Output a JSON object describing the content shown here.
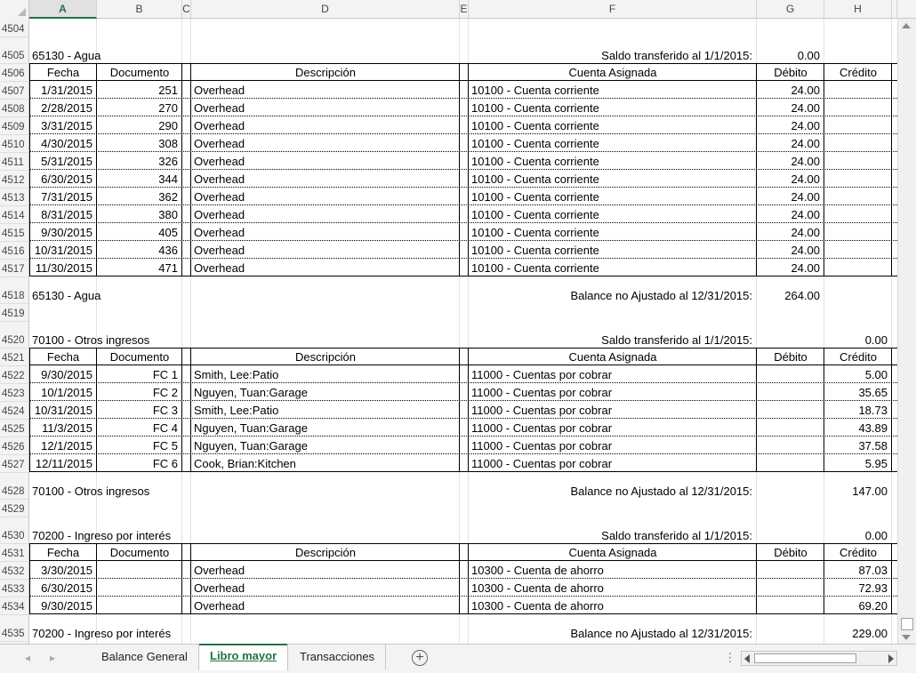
{
  "columns": [
    "A",
    "B",
    "C",
    "D",
    "E",
    "F",
    "G",
    "H"
  ],
  "row_numbers": [
    "4504",
    "4505",
    "4506",
    "4507",
    "4508",
    "4509",
    "4510",
    "4511",
    "4512",
    "4513",
    "4514",
    "4515",
    "4516",
    "4517",
    "4518",
    "4519",
    "4520",
    "4521",
    "4522",
    "4523",
    "4524",
    "4525",
    "4526",
    "4527",
    "4528",
    "4529",
    "4530",
    "4531",
    "4532",
    "4533",
    "4534",
    "4535"
  ],
  "headers": {
    "fecha": "Fecha",
    "documento": "Documento",
    "descripcion": "Descripción",
    "cuenta": "Cuenta Asignada",
    "debito": "Débito",
    "credito": "Crédito"
  },
  "sections": [
    {
      "account": "65130 - Agua",
      "opening_label": "Saldo transferido al 1/1/2015:",
      "opening_debit": "0.00",
      "opening_credit": "",
      "rows": [
        {
          "fecha": "1/31/2015",
          "doc": "251",
          "desc": "Overhead",
          "cuenta": "10100 - Cuenta corriente",
          "debito": "24.00",
          "credito": ""
        },
        {
          "fecha": "2/28/2015",
          "doc": "270",
          "desc": "Overhead",
          "cuenta": "10100 - Cuenta corriente",
          "debito": "24.00",
          "credito": ""
        },
        {
          "fecha": "3/31/2015",
          "doc": "290",
          "desc": "Overhead",
          "cuenta": "10100 - Cuenta corriente",
          "debito": "24.00",
          "credito": ""
        },
        {
          "fecha": "4/30/2015",
          "doc": "308",
          "desc": "Overhead",
          "cuenta": "10100 - Cuenta corriente",
          "debito": "24.00",
          "credito": ""
        },
        {
          "fecha": "5/31/2015",
          "doc": "326",
          "desc": "Overhead",
          "cuenta": "10100 - Cuenta corriente",
          "debito": "24.00",
          "credito": ""
        },
        {
          "fecha": "6/30/2015",
          "doc": "344",
          "desc": "Overhead",
          "cuenta": "10100 - Cuenta corriente",
          "debito": "24.00",
          "credito": ""
        },
        {
          "fecha": "7/31/2015",
          "doc": "362",
          "desc": "Overhead",
          "cuenta": "10100 - Cuenta corriente",
          "debito": "24.00",
          "credito": ""
        },
        {
          "fecha": "8/31/2015",
          "doc": "380",
          "desc": "Overhead",
          "cuenta": "10100 - Cuenta corriente",
          "debito": "24.00",
          "credito": ""
        },
        {
          "fecha": "9/30/2015",
          "doc": "405",
          "desc": "Overhead",
          "cuenta": "10100 - Cuenta corriente",
          "debito": "24.00",
          "credito": ""
        },
        {
          "fecha": "10/31/2015",
          "doc": "436",
          "desc": "Overhead",
          "cuenta": "10100 - Cuenta corriente",
          "debito": "24.00",
          "credito": ""
        },
        {
          "fecha": "11/30/2015",
          "doc": "471",
          "desc": "Overhead",
          "cuenta": "10100 - Cuenta corriente",
          "debito": "24.00",
          "credito": ""
        }
      ],
      "closing_account": "65130 - Agua",
      "closing_label": "Balance no Ajustado al 12/31/2015:",
      "closing_debit": "264.00",
      "closing_credit": ""
    },
    {
      "account": "70100 - Otros ingresos",
      "opening_label": "Saldo transferido al 1/1/2015:",
      "opening_debit": "",
      "opening_credit": "0.00",
      "rows": [
        {
          "fecha": "9/30/2015",
          "doc": "FC 1",
          "desc": "Smith, Lee:Patio",
          "cuenta": "11000 - Cuentas por cobrar",
          "debito": "",
          "credito": "5.00"
        },
        {
          "fecha": "10/1/2015",
          "doc": "FC 2",
          "desc": "Nguyen, Tuan:Garage",
          "cuenta": "11000 - Cuentas por cobrar",
          "debito": "",
          "credito": "35.65"
        },
        {
          "fecha": "10/31/2015",
          "doc": "FC 3",
          "desc": "Smith, Lee:Patio",
          "cuenta": "11000 - Cuentas por cobrar",
          "debito": "",
          "credito": "18.73"
        },
        {
          "fecha": "11/3/2015",
          "doc": "FC 4",
          "desc": "Nguyen, Tuan:Garage",
          "cuenta": "11000 - Cuentas por cobrar",
          "debito": "",
          "credito": "43.89"
        },
        {
          "fecha": "12/1/2015",
          "doc": "FC 5",
          "desc": "Nguyen, Tuan:Garage",
          "cuenta": "11000 - Cuentas por cobrar",
          "debito": "",
          "credito": "37.58"
        },
        {
          "fecha": "12/11/2015",
          "doc": "FC 6",
          "desc": "Cook, Brian:Kitchen",
          "cuenta": "11000 - Cuentas por cobrar",
          "debito": "",
          "credito": "5.95"
        }
      ],
      "closing_account": "70100 - Otros ingresos",
      "closing_label": "Balance no Ajustado al 12/31/2015:",
      "closing_debit": "",
      "closing_credit": "147.00"
    },
    {
      "account": "70200 - Ingreso por interés",
      "opening_label": "Saldo transferido al 1/1/2015:",
      "opening_debit": "",
      "opening_credit": "0.00",
      "rows": [
        {
          "fecha": "3/30/2015",
          "doc": "",
          "desc": "Overhead",
          "cuenta": "10300 - Cuenta de ahorro",
          "debito": "",
          "credito": "87.03"
        },
        {
          "fecha": "6/30/2015",
          "doc": "",
          "desc": "Overhead",
          "cuenta": "10300 - Cuenta de ahorro",
          "debito": "",
          "credito": "72.93"
        },
        {
          "fecha": "9/30/2015",
          "doc": "",
          "desc": "Overhead",
          "cuenta": "10300 - Cuenta de ahorro",
          "debito": "",
          "credito": "69.20"
        }
      ],
      "closing_account": "70200 - Ingreso por interés",
      "closing_label": "Balance no Ajustado al 12/31/2015:",
      "closing_debit": "",
      "closing_credit": "229.00"
    }
  ],
  "tabs": [
    {
      "label": "Balance General",
      "active": false
    },
    {
      "label": "Libro mayor",
      "active": true
    },
    {
      "label": "Transacciones",
      "active": false
    }
  ],
  "selected_column": "A",
  "accent_color": "#217346"
}
